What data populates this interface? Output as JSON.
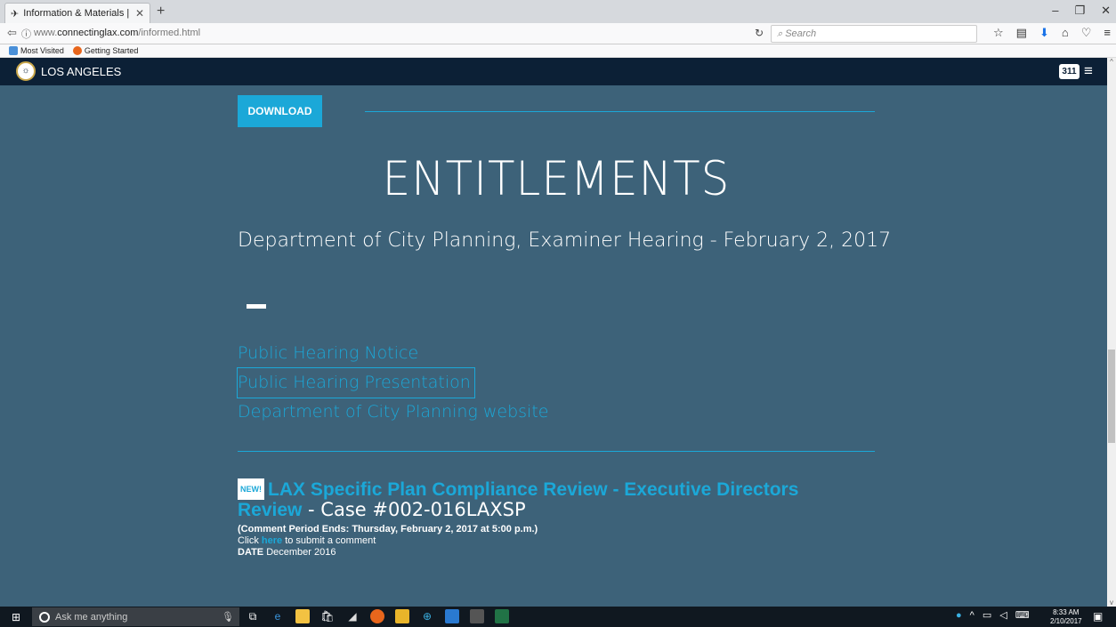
{
  "browser": {
    "tab_title": "Information & Materials | ...",
    "tab_close": "✕",
    "new_tab": "+",
    "url_prefix": "www.",
    "url_domain": "connectinglax.com",
    "url_path": "/informed.html",
    "search_placeholder": "Search",
    "bookmarks": [
      {
        "label": "Most Visited",
        "color": "#4a90d9"
      },
      {
        "label": "Getting Started",
        "color": "#e8661c"
      }
    ]
  },
  "site": {
    "name": "LOS ANGELES",
    "badge_311": "311"
  },
  "content": {
    "download_label": "DOWNLOAD",
    "heading": "ENTITLEMENTS",
    "subheading": "Department of City Planning, Examiner Hearing - February 2, 2017",
    "links": [
      "Public Hearing Notice",
      "Public Hearing Presentation",
      "Department of City Planning website"
    ],
    "news": {
      "badge": "NEW!",
      "title": "LAX Specific Plan Compliance Review - Executive Directors Review",
      "case": " - Case #002-016LAXSP",
      "comment_period": "(Comment Period Ends: Thursday, February 2, 2017 at 5:00 p.m.)",
      "click_prefix": "Click ",
      "click_link": "here",
      "click_suffix": " to submit a comment",
      "date_label": "DATE",
      "date_value": " December 2016"
    }
  },
  "taskbar": {
    "search_placeholder": "Ask me anything",
    "time": "8:33 AM",
    "date": "2/10/2017"
  },
  "colors": {
    "accent": "#1ba8d8",
    "page_bg": "#3d6279",
    "header_bg": "#0c2036"
  }
}
